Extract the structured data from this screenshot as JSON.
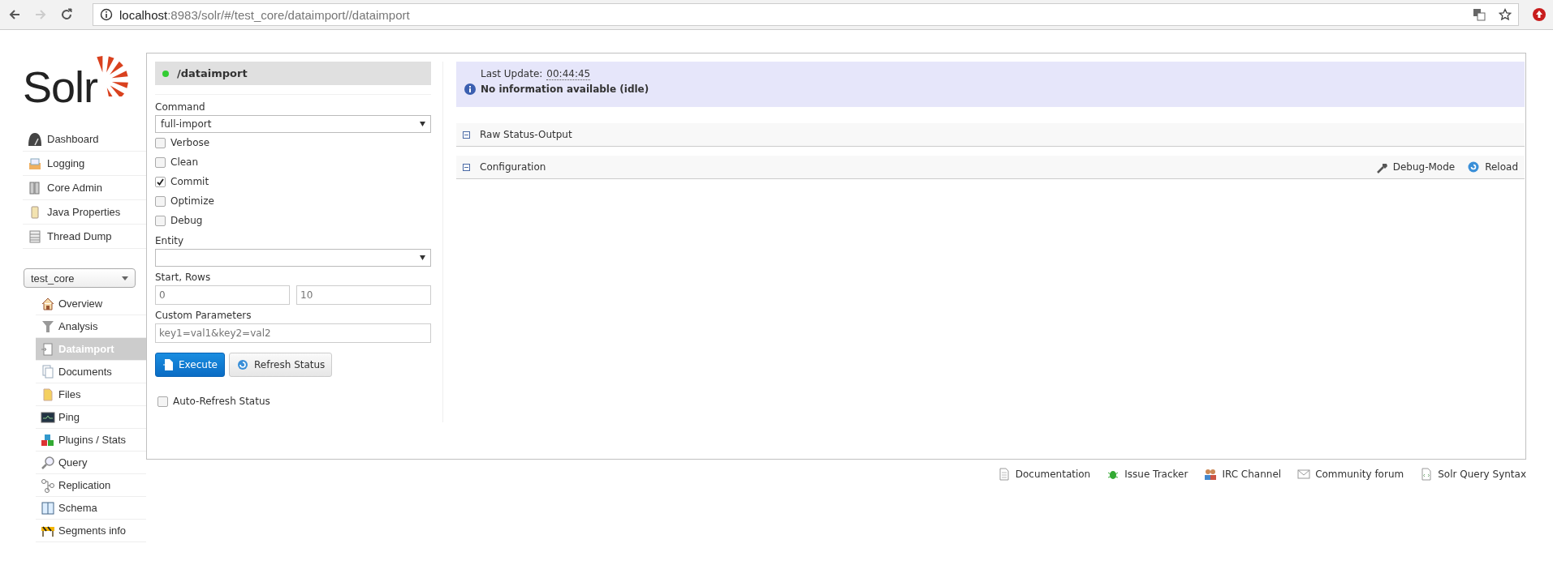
{
  "browser": {
    "url_host": "localhost",
    "url_path": ":8983/solr/#/test_core/dataimport//dataimport"
  },
  "sidebar": {
    "logo": "Solr",
    "nav": [
      {
        "label": "Dashboard"
      },
      {
        "label": "Logging"
      },
      {
        "label": "Core Admin"
      },
      {
        "label": "Java Properties"
      },
      {
        "label": "Thread Dump"
      }
    ],
    "core_selector": {
      "value": "test_core"
    },
    "core_nav": [
      {
        "label": "Overview",
        "selected": false
      },
      {
        "label": "Analysis",
        "selected": false
      },
      {
        "label": "Dataimport",
        "selected": true
      },
      {
        "label": "Documents",
        "selected": false
      },
      {
        "label": "Files",
        "selected": false
      },
      {
        "label": "Ping",
        "selected": false
      },
      {
        "label": "Plugins / Stats",
        "selected": false
      },
      {
        "label": "Query",
        "selected": false
      },
      {
        "label": "Replication",
        "selected": false
      },
      {
        "label": "Schema",
        "selected": false
      },
      {
        "label": "Segments info",
        "selected": false
      }
    ]
  },
  "form": {
    "handler": "/dataimport",
    "command": {
      "label": "Command",
      "value": "full-import"
    },
    "options": [
      {
        "label": "Verbose",
        "checked": false
      },
      {
        "label": "Clean",
        "checked": false
      },
      {
        "label": "Commit",
        "checked": true
      },
      {
        "label": "Optimize",
        "checked": false
      },
      {
        "label": "Debug",
        "checked": false
      }
    ],
    "entity": {
      "label": "Entity"
    },
    "start_rows": {
      "label": "Start, Rows",
      "start_placeholder": "0",
      "rows_placeholder": "10"
    },
    "custom_parameters": {
      "label": "Custom Parameters",
      "placeholder": "key1=val1&key2=val2"
    },
    "buttons": [
      {
        "label": "Execute",
        "kind": "primary"
      },
      {
        "label": "Refresh Status",
        "kind": "secondary"
      }
    ],
    "auto_refresh": {
      "label": "Auto-Refresh Status",
      "checked": false
    }
  },
  "status": {
    "last_update_label": "Last Update:",
    "last_update_time": "00:44:45",
    "message": "No information available (idle)"
  },
  "sections": [
    {
      "title": "Raw Status-Output",
      "expanded": true
    },
    {
      "title": "Configuration",
      "expanded": true,
      "actions": [
        {
          "label": "Debug-Mode"
        },
        {
          "label": "Reload"
        }
      ]
    }
  ],
  "footer": [
    {
      "label": "Documentation"
    },
    {
      "label": "Issue Tracker"
    },
    {
      "label": "IRC Channel"
    },
    {
      "label": "Community forum"
    },
    {
      "label": "Solr Query Syntax"
    }
  ]
}
